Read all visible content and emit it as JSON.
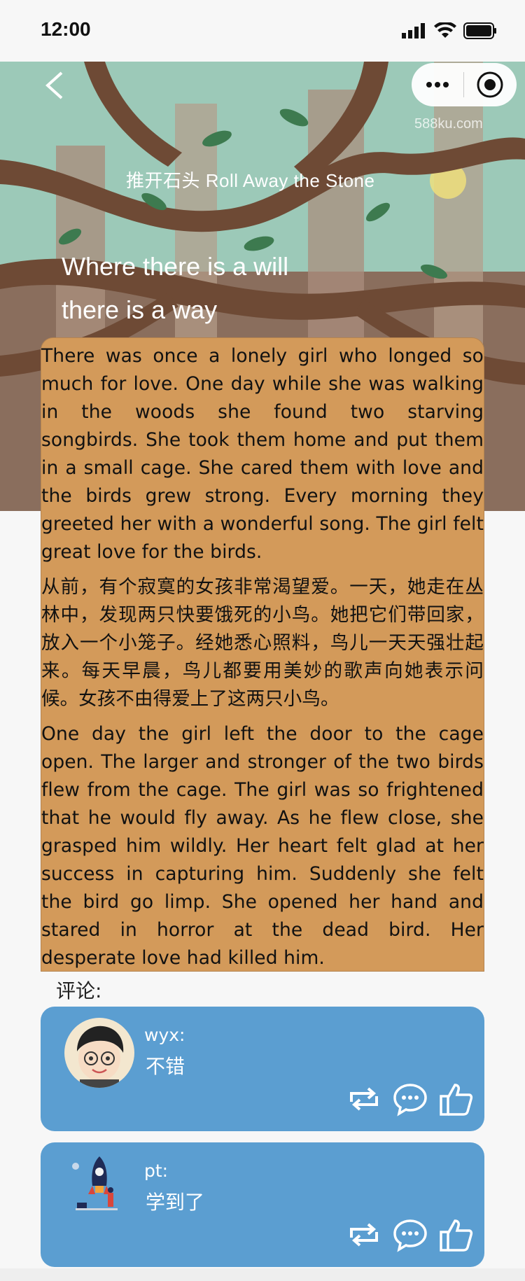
{
  "status_bar": {
    "time": "12:00"
  },
  "header": {
    "watermark": "588ku.com",
    "subtitle": "推开石头 Roll Away the Stone",
    "motto_line1": "Where there is a will",
    "motto_line2": "there is a way"
  },
  "article": {
    "paragraphs": [
      "There was once a lonely girl who longed so much for love. One day while she was walking in the woods she found two starving songbirds. She took them home and put them in a small cage. She cared them with love and the birds grew strong. Every morning they greeted her with a wonderful song. The girl felt great love for the birds.",
      "从前，有个寂寞的女孩非常渴望爱。一天，她走在丛林中，发现两只快要饿死的小鸟。她把它们带回家，放入一个小笼子。经她悉心照料，鸟儿一天天强壮起来。每天早晨，鸟儿都要用美妙的歌声向她表示问候。女孩不由得爱上了这两只小鸟。",
      "One day the girl left the door to the cage open. The larger and stronger of the two birds flew from the cage. The girl was so frightened that he would fly away. As he flew close, she grasped him wildly. Her heart felt glad at her success in capturing him. Suddenly she felt the bird go limp. She opened her hand and stared in horror at the dead bird. Her desperate love had killed him."
    ]
  },
  "comments": {
    "label": "评论:",
    "items": [
      {
        "user": "wyx:",
        "text": "不错",
        "avatar": "boy-avatar-icon"
      },
      {
        "user": "pt:",
        "text": "学到了",
        "avatar": "rocket-avatar-icon"
      }
    ]
  },
  "colors": {
    "article_bg": "#d39a5a",
    "comment_bg": "#5b9ed1",
    "hero_tree": "#6e4a35",
    "hero_sky": "#9cc9b8"
  },
  "icons": [
    "back-arrow-icon",
    "more-icon",
    "close-target-icon",
    "repost-icon",
    "comment-icon",
    "like-icon"
  ]
}
